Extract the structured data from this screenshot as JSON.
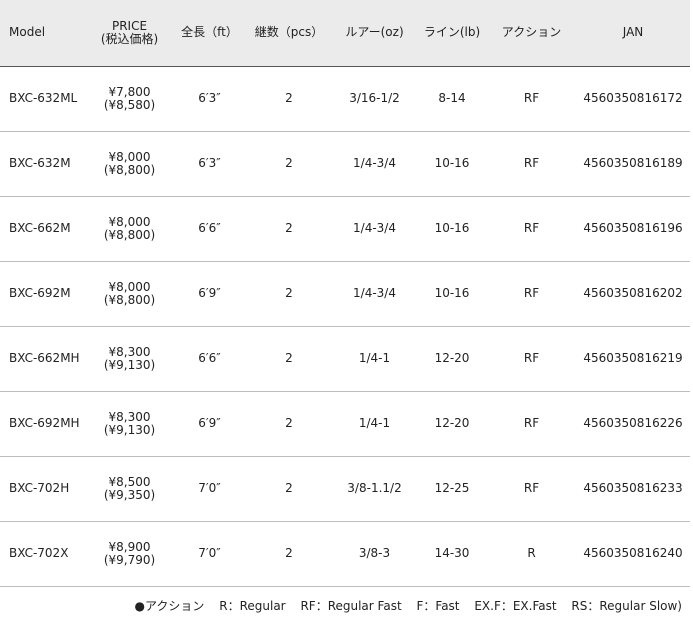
{
  "columns": {
    "model": "Model",
    "price_line1": "PRICE",
    "price_line2": "(税込価格)",
    "length": "全長（ft）",
    "pieces": "継数（pcs）",
    "lure": "ルアー(oz)",
    "line": "ライン(lb)",
    "action": "アクション",
    "jan": "JAN"
  },
  "rows": [
    {
      "model": "BXC-632ML",
      "price": "¥7,800",
      "price_tax": "(¥8,580)",
      "length": "6′3″",
      "pieces": "2",
      "lure": "3/16-1/2",
      "line": "8-14",
      "action": "RF",
      "jan": "4560350816172"
    },
    {
      "model": "BXC-632M",
      "price": "¥8,000",
      "price_tax": "(¥8,800)",
      "length": "6′3″",
      "pieces": "2",
      "lure": "1/4-3/4",
      "line": "10-16",
      "action": "RF",
      "jan": "4560350816189"
    },
    {
      "model": "BXC-662M",
      "price": "¥8,000",
      "price_tax": "(¥8,800)",
      "length": "6′6″",
      "pieces": "2",
      "lure": "1/4-3/4",
      "line": "10-16",
      "action": "RF",
      "jan": "4560350816196"
    },
    {
      "model": "BXC-692M",
      "price": "¥8,000",
      "price_tax": "(¥8,800)",
      "length": "6′9″",
      "pieces": "2",
      "lure": "1/4-3/4",
      "line": "10-16",
      "action": "RF",
      "jan": "4560350816202"
    },
    {
      "model": "BXC-662MH",
      "price": "¥8,300",
      "price_tax": "(¥9,130)",
      "length": "6′6″",
      "pieces": "2",
      "lure": "1/4-1",
      "line": "12-20",
      "action": "RF",
      "jan": "4560350816219"
    },
    {
      "model": "BXC-692MH",
      "price": "¥8,300",
      "price_tax": "(¥9,130)",
      "length": "6′9″",
      "pieces": "2",
      "lure": "1/4-1",
      "line": "12-20",
      "action": "RF",
      "jan": "4560350816226"
    },
    {
      "model": "BXC-702H",
      "price": "¥8,500",
      "price_tax": "(¥9,350)",
      "length": "7′0″",
      "pieces": "2",
      "lure": "3/8-1.1/2",
      "line": "12-25",
      "action": "RF",
      "jan": "4560350816233"
    },
    {
      "model": "BXC-702X",
      "price": "¥8,900",
      "price_tax": "(¥9,790)",
      "length": "7′0″",
      "pieces": "2",
      "lure": "3/8-3",
      "line": "14-30",
      "action": "R",
      "jan": "4560350816240"
    }
  ],
  "legend": {
    "title": "●アクション",
    "items": [
      "R：Regular",
      "RF：Regular Fast",
      "F：Fast",
      "EX.F：EX.Fast",
      "RS：Regular Slow)"
    ]
  }
}
